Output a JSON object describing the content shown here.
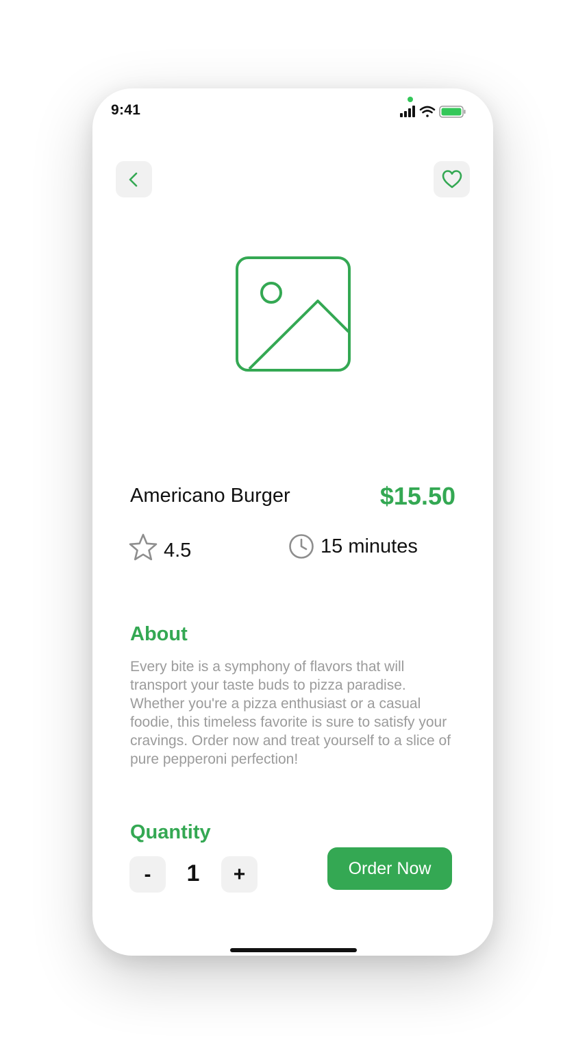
{
  "status_bar": {
    "time": "9:41",
    "icons": [
      "signal-bars-icon",
      "wifi-icon",
      "battery-icon"
    ]
  },
  "colors": {
    "accent": "#34a853",
    "text": "#111111",
    "muted": "#9b9b9b",
    "button_bg": "#f1f1f1"
  },
  "header": {
    "back_icon": "chevron-left-icon",
    "favorite_icon": "heart-icon"
  },
  "product": {
    "image_icon": "image-placeholder-icon",
    "name": "Americano Burger",
    "price": "$15.50",
    "rating": "4.5",
    "rating_icon": "star-icon",
    "prep_time": "15 minutes",
    "time_icon": "clock-icon"
  },
  "about": {
    "title": "About",
    "text": "Every bite is a symphony of flavors that will transport your taste buds to pizza paradise. Whether you're a pizza enthusiast or a casual foodie, this timeless favorite is sure to satisfy your cravings. Order now and treat yourself to a slice of pure pepperoni perfection!"
  },
  "quantity": {
    "title": "Quantity",
    "decrement_label": "-",
    "value": "1",
    "increment_label": "+"
  },
  "actions": {
    "order_label": "Order Now"
  }
}
